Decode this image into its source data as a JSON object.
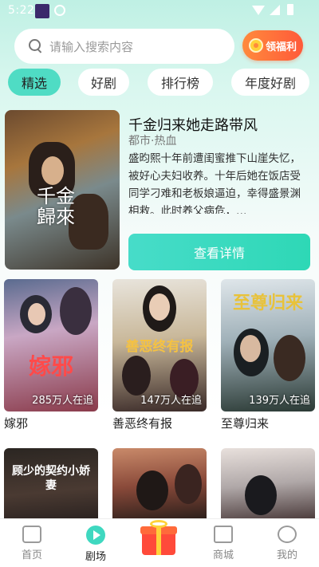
{
  "status_bar": {
    "time": "5:22"
  },
  "search": {
    "placeholder": "请输入搜索内容"
  },
  "welfare_button": {
    "label": "领福利"
  },
  "tabs": [
    {
      "label": "精选",
      "active": true
    },
    {
      "label": "好剧",
      "active": false
    },
    {
      "label": "排行榜",
      "active": false
    },
    {
      "label": "年度好剧",
      "active": false
    }
  ],
  "featured": {
    "title": "千金归来她走路带风",
    "genre": "都市·热血",
    "description": "盛昀熙十年前遭闺蜜推下山崖失忆，被好心夫妇收养。十年后她在饭店受同学刁难和老板娘逼迫，幸得盛景渊相救。此时养父病危，…",
    "poster_text": "千金歸來",
    "details_button": "查看详情"
  },
  "grid": [
    {
      "title": "嫁邪",
      "views": "285万人在追",
      "poster_text": "嫁邪"
    },
    {
      "title": "善恶终有报",
      "views": "147万人在追",
      "poster_text": "善恶终有报"
    },
    {
      "title": "至尊归来",
      "views": "139万人在追",
      "poster_text": "至尊归来"
    }
  ],
  "grid_row2": [
    {
      "poster_text": "顾少的契约小娇妻"
    },
    {
      "poster_text": ""
    },
    {
      "poster_text": ""
    }
  ],
  "bottom_nav": [
    {
      "label": "首页",
      "icon": "home-icon",
      "active": false
    },
    {
      "label": "剧场",
      "icon": "play-icon",
      "active": true
    },
    {
      "label": "",
      "icon": "gift-icon",
      "active": false
    },
    {
      "label": "商城",
      "icon": "store-icon",
      "active": false
    },
    {
      "label": "我的",
      "icon": "smile-icon",
      "active": false
    }
  ],
  "colors": {
    "accent": "#4fdcc4",
    "welfare": "#ff6a3a",
    "details_button": "#2ed8b6"
  }
}
